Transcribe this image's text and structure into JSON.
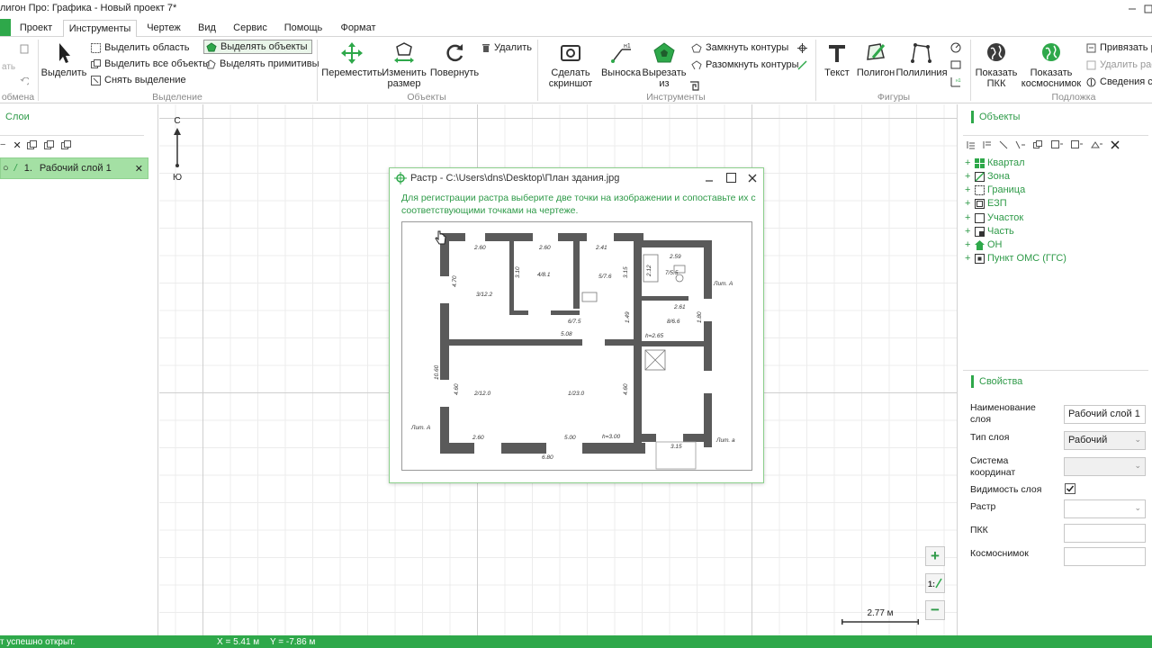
{
  "window": {
    "title": "лигон Про: Графика - Новый проект 7*"
  },
  "menu": {
    "tabs": [
      "Проект",
      "Инструменты",
      "Чертеж",
      "Вид",
      "Сервис",
      "Помощь",
      "Формат"
    ],
    "active": "Инструменты"
  },
  "ribbon": {
    "clipboard_group_label": "обмена",
    "selection": {
      "select_label": "Выделить",
      "select_area": "Выделить область",
      "select_all_objects": "Выделить все объекты",
      "clear_selection": "Снять выделение",
      "select_objects_mode": "Выделять объекты",
      "select_primitives_mode": "Выделять примитивы",
      "group_label": "Выделение",
      "delete_label": "Удалить"
    },
    "objects": {
      "move": "Переместить",
      "resize": "Изменить размер",
      "rotate": "Повернуть",
      "group_label": "Объекты"
    },
    "tools": {
      "screenshot": "Сделать скриншот",
      "callout": "Выноска",
      "cut_from": "Вырезать из",
      "close_contours": "Замкнуть контуры",
      "open_contours": "Разомкнуть контуры",
      "group_label": "Инструменты"
    },
    "shapes": {
      "text": "Текст",
      "polygon": "Полигон",
      "polyline": "Полилиния",
      "group_label": "Фигуры"
    },
    "underlay": {
      "show_pkk": "Показать ПКК",
      "show_satellite": "Показать космоснимок",
      "bind_raster": "Привязать ра",
      "delete_raster": "Удалить раст",
      "info": "Сведения с П",
      "group_label": "Подложка"
    }
  },
  "layers_panel": {
    "title": "Слои",
    "layers": [
      {
        "index": "1.",
        "name": "Рабочий слой 1"
      }
    ]
  },
  "canvas": {
    "north_label": "С",
    "south_label": "Ю",
    "scale_label": "2.77 м"
  },
  "raster_dialog": {
    "title": "Растр - C:\\Users\\dns\\Desktop\\План здания.jpg",
    "hint": "Для регистрации растра выберите две точки на изображении и сопоставьте их с соответствующими точками на чертеже.",
    "plan_labels": [
      "2.60",
      "2.60",
      "2.41",
      "2.59",
      "4.70",
      "3.10",
      "3.15",
      "2.12",
      "2.61",
      "1.49",
      "1.80",
      "5.08",
      "h=2.65",
      "10.60",
      "4.60",
      "4.60",
      "2.60",
      "5.00",
      "h=3.00",
      "3.15",
      "6.80",
      "Лит. А",
      "Лит. А",
      "Лит. а",
      "3/12.2",
      "4/8.1",
      "5/7.6",
      "6/7.5",
      "7/5.5",
      "8/6.6",
      "2/12.0",
      "1/23.0"
    ]
  },
  "objects_panel": {
    "title": "Объекты",
    "items": [
      "Квартал",
      "Зона",
      "Граница",
      "ЕЗП",
      "Участок",
      "Часть",
      "ОН",
      "Пункт ОМС (ГГС)"
    ]
  },
  "properties_panel": {
    "title": "Свойства",
    "name_label": "Наименование слоя",
    "name_value": "Рабочий слой 1",
    "type_label": "Тип слоя",
    "type_value": "Рабочий",
    "coords_label": "Система координат",
    "coords_value": "",
    "visibility_label": "Видимость слоя",
    "raster_label": "Растр",
    "raster_value": "",
    "pkk_label": "ПКК",
    "pkk_value": "",
    "satellite_label": "Космоснимок",
    "satellite_value": ""
  },
  "status": {
    "message": "т успешно открыт.",
    "x": "X = 5.41 м",
    "y": "Y = -7.86 м"
  },
  "colors": {
    "accent": "#2ea84a",
    "layer_selected": "#a4e0a4",
    "grid": "#cfcfcf"
  }
}
